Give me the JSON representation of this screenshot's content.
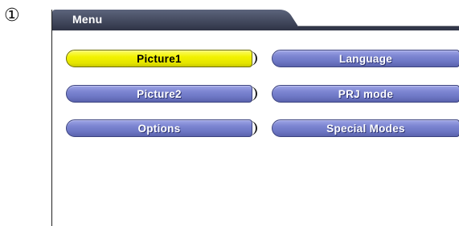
{
  "step_marker": "①",
  "menu": {
    "tab_title": "Menu",
    "colors": {
      "tab_fill": "#3f465b",
      "button_fill": "#7d86d2",
      "selected_fill": "#f2f200"
    },
    "items": [
      {
        "label": "Picture1",
        "selected": true
      },
      {
        "label": "Language",
        "selected": false
      },
      {
        "label": "Picture2",
        "selected": false
      },
      {
        "label": "PRJ mode",
        "selected": false
      },
      {
        "label": "Options",
        "selected": false
      },
      {
        "label": "Special Modes",
        "selected": false
      }
    ]
  }
}
